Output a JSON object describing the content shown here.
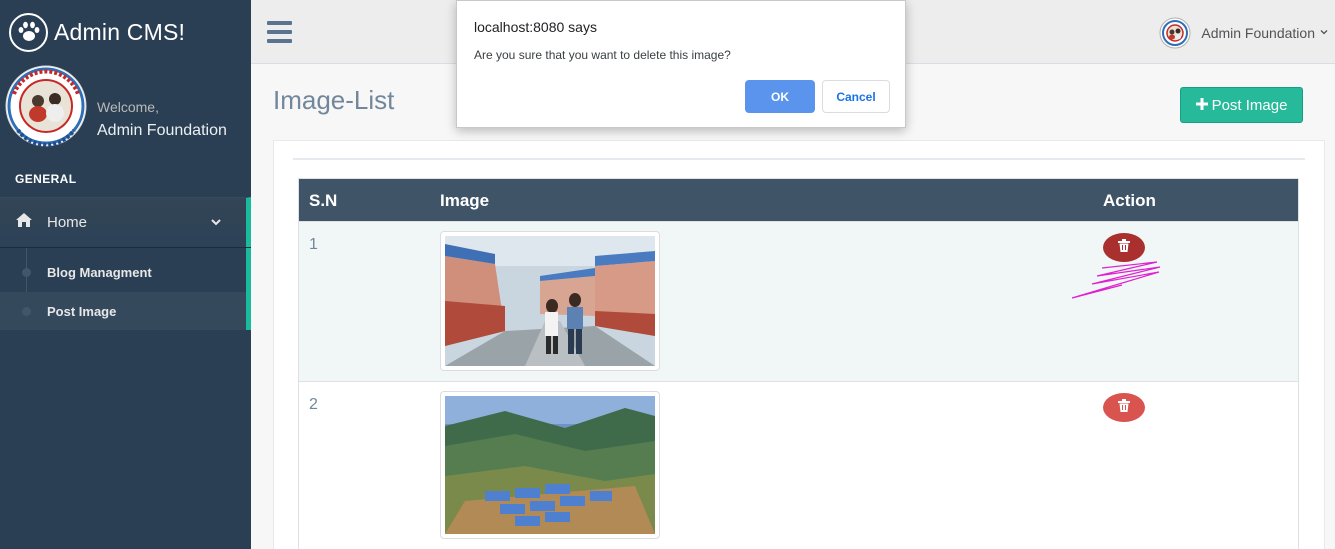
{
  "brand": {
    "title": "Admin CMS!",
    "icon": "paw-icon"
  },
  "profile": {
    "welcome": "Welcome,",
    "name": "Admin Foundation"
  },
  "sidebar": {
    "section": "GENERAL",
    "home": {
      "label": "Home",
      "icon": "home-icon"
    },
    "submenu": [
      {
        "label": "Blog Managment"
      },
      {
        "label": "Post Image"
      }
    ]
  },
  "topnav": {
    "user_name": "Admin Foundation",
    "menu_icon": "hamburger-icon"
  },
  "page": {
    "title": "Image-List",
    "post_button": "Post Image"
  },
  "table": {
    "headers": {
      "sn": "S.N",
      "image": "Image",
      "action": "Action"
    },
    "rows": [
      {
        "sn": "1"
      },
      {
        "sn": "2"
      }
    ]
  },
  "dialog": {
    "title": "localhost:8080 says",
    "message": "Are you sure that you want to delete this image?",
    "ok": "OK",
    "cancel": "Cancel"
  },
  "colors": {
    "sidebar": "#2a3f54",
    "accent": "#1abb9c",
    "success": "#26b99a",
    "danger": "#d9534f",
    "table_header": "#405467",
    "dialog_ok": "#5a94ec"
  }
}
